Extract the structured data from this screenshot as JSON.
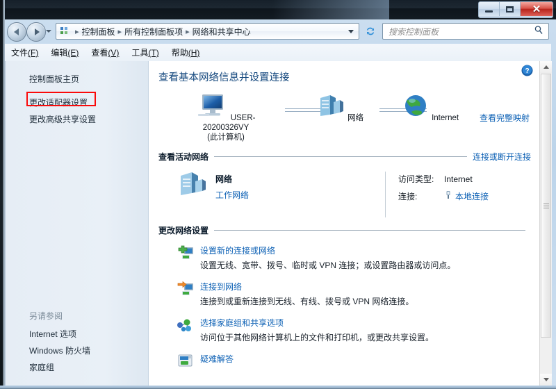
{
  "window": {
    "buttons": {
      "minimize": "–",
      "maximize": "□",
      "close": "✕"
    }
  },
  "toolbar": {
    "back_label": "后退",
    "forward_label": "前进",
    "recent_dropdown_label": "最近浏览的位置",
    "breadcrumbs": [
      "控制面板",
      "所有控制面板项",
      "网络和共享中心"
    ],
    "separator": "▸",
    "refresh_label": "刷新"
  },
  "search": {
    "placeholder": "搜索控制面板",
    "value": ""
  },
  "menubar": {
    "items": [
      {
        "text": "文件",
        "accel": "(F)"
      },
      {
        "text": "编辑",
        "accel": "(E)"
      },
      {
        "text": "查看",
        "accel": "(V)"
      },
      {
        "text": "工具",
        "accel": "(T)"
      },
      {
        "text": "帮助",
        "accel": "(H)"
      }
    ]
  },
  "sidebar": {
    "home_link": "控制面板主页",
    "tasks": [
      {
        "label": "更改适配器设置",
        "highlighted": true
      },
      {
        "label": "更改高级共享设置",
        "highlighted": false
      }
    ],
    "see_also_title": "另请参阅",
    "see_also": [
      "Internet 选项",
      "Windows 防火墙",
      "家庭组"
    ]
  },
  "main": {
    "page_title": "查看基本网络信息并设置连接",
    "help_label": "帮助",
    "network_map": {
      "nodes": [
        {
          "name": "USER-20200326VY",
          "sub": "(此计算机)",
          "icon": "computer-icon"
        },
        {
          "name": "网络",
          "sub": "",
          "icon": "server-icon"
        },
        {
          "name": "Internet",
          "sub": "",
          "icon": "globe-icon"
        }
      ],
      "full_map_link": "查看完整映射"
    },
    "active_networks": {
      "section_title": "查看活动网络",
      "section_link": "连接或断开连接",
      "network_name": "网络",
      "network_type": "工作网络",
      "access_type_key": "访问类型:",
      "access_type_value": "Internet",
      "connection_key": "连接:",
      "connection_value": "本地连接"
    },
    "change_settings": {
      "section_title": "更改网络设置",
      "items": [
        {
          "icon": "new-connection-icon",
          "title": "设置新的连接或网络",
          "desc": "设置无线、宽带、拨号、临时或 VPN 连接；或设置路由器或访问点。"
        },
        {
          "icon": "connect-network-icon",
          "title": "连接到网络",
          "desc": "连接到或重新连接到无线、有线、拨号或 VPN 网络连接。"
        },
        {
          "icon": "homegroup-icon",
          "title": "选择家庭组和共享选项",
          "desc": "访问位于其他网络计算机上的文件和打印机，或更改共享设置。"
        },
        {
          "icon": "troubleshoot-icon",
          "title": "疑难解答",
          "desc": ""
        }
      ]
    }
  },
  "scrollbar": {
    "up_label": "向上滚动",
    "down_label": "向下滚动"
  },
  "colors": {
    "link": "#0a5fb4",
    "title": "#13477d",
    "highlight": "#fa0a0a",
    "close_button": "#c0392b"
  }
}
